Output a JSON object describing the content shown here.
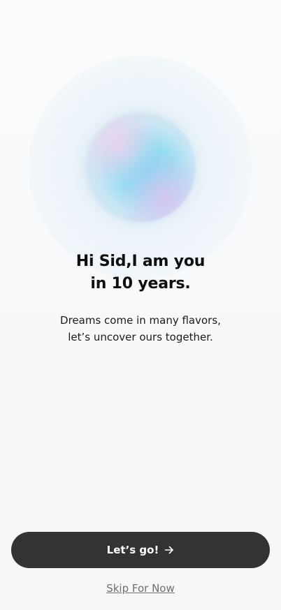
{
  "hero": {
    "title_line1": "Hi Sid,I am you",
    "title_line2": "in 10 years.",
    "subtitle_line1": "Dreams come in many flavors,",
    "subtitle_line2": "let’s uncover ours together."
  },
  "actions": {
    "primary_label": "Let’s go!",
    "primary_icon": "arrow-right-icon",
    "secondary_label": "Skip For Now"
  },
  "colors": {
    "background": "#f7f8fa",
    "primary_button": "#323434",
    "primary_text": "#ffffff",
    "link_text": "#6f6f6f",
    "orb_accent": "#78d6f0"
  }
}
